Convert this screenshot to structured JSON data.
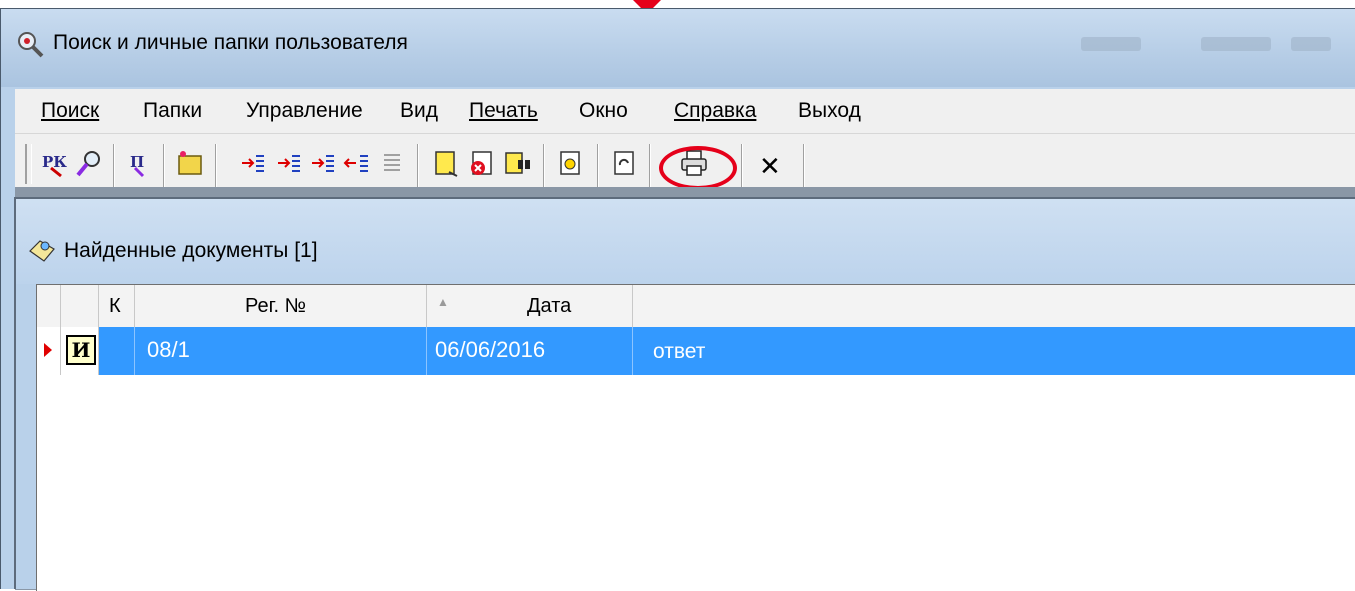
{
  "window": {
    "title": "Поиск и личные папки пользователя"
  },
  "menu": [
    {
      "label": "Поиск",
      "underline_index": 0
    },
    {
      "label": "Папки",
      "underline_index": 1
    },
    {
      "label": "Управление"
    },
    {
      "label": "Вид"
    },
    {
      "label": "Печать",
      "underline_index": 0
    },
    {
      "label": "Окно"
    },
    {
      "label": "Справка",
      "underline_index": 0
    },
    {
      "label": "Выход"
    }
  ],
  "toolbar": {
    "buttons": [
      "rk-search-icon",
      "search-icon",
      "personal-folder-icon",
      "new-folder-icon",
      "move-right-icon",
      "move-right-2-icon",
      "move-right-3-icon",
      "move-left-icon",
      "list-icon",
      "document-icon",
      "delete-document-icon",
      "find-icon",
      "view-icon",
      "refresh-icon",
      "printer-icon",
      "close-icon"
    ],
    "close_glyph": "✕",
    "highlight_color": "#e5001a"
  },
  "child": {
    "title": "Найденные документы [1]"
  },
  "table": {
    "columns": [
      "К",
      "Рег. №",
      "Дата",
      ""
    ],
    "rows": [
      {
        "type": "И",
        "k": "",
        "reg_no": "08/1",
        "date": "06/06/2016",
        "desc": "ответ"
      }
    ],
    "selected_color": "#3399ff"
  }
}
